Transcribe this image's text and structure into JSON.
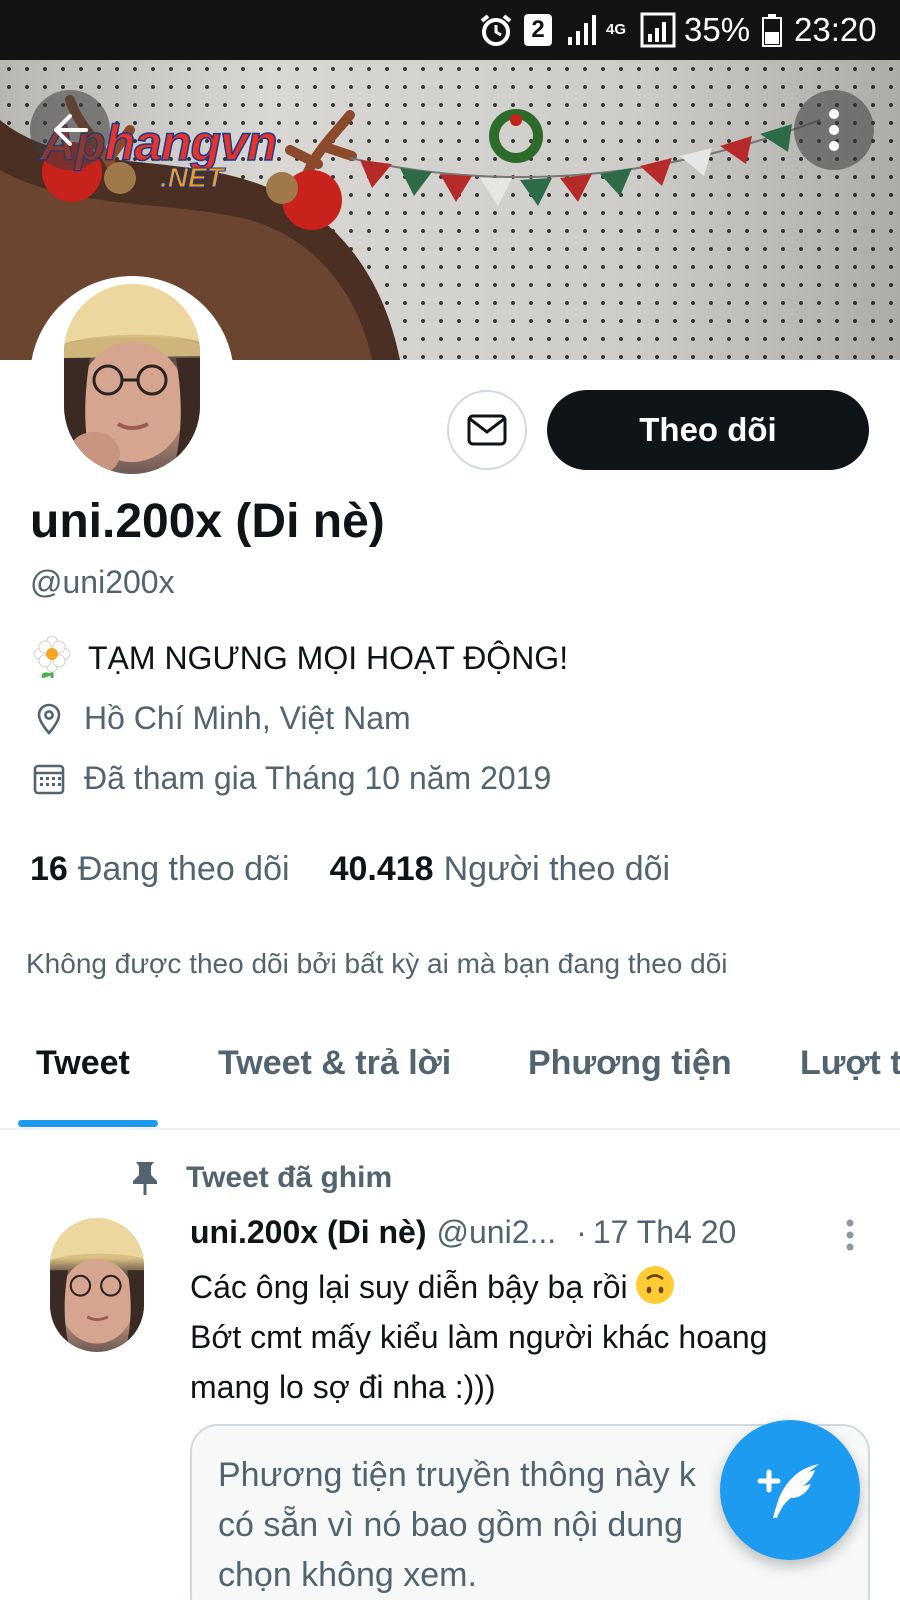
{
  "status_bar": {
    "notification_count": "2",
    "network": "4G",
    "battery": "35%",
    "time": "23:20"
  },
  "watermark": {
    "line1": "Aphangvn",
    "line2": ".NET"
  },
  "profile": {
    "display_name": "uni.200x (Di nè)",
    "handle": "@uni200x",
    "bio": "TẠM NGƯNG MỌI HOẠT ĐỘNG!",
    "location": "Hồ Chí Minh, Việt Nam",
    "joined": "Đã tham gia Tháng 10 năm 2019",
    "following_count": "16",
    "following_label": "Đang theo dõi",
    "followers_count": "40.418",
    "followers_label": "Người theo dõi",
    "follow_button": "Theo dõi",
    "not_followed_notice": "Không được theo dõi bởi bất kỳ ai mà bạn đang theo dõi"
  },
  "tabs": [
    {
      "label": "Tweet",
      "active": true
    },
    {
      "label": "Tweet & trả lời",
      "active": false
    },
    {
      "label": "Phương tiện",
      "active": false
    },
    {
      "label": "Lượt t",
      "active": false
    }
  ],
  "tweet": {
    "pinned_label": "Tweet đã ghim",
    "author_name": "uni.200x (Di nè)",
    "author_handle": "@uni2...",
    "separator": "·",
    "date": "17 Th4 20",
    "text_line1": "Các ông lại suy diễn bậy bạ rồi",
    "text_line2": "Bớt cmt mấy kiểu làm người khác hoang",
    "text_line3": "mang lo sợ đi nha :)))",
    "media_notice_line1": "Phương tiện truyền thông này k",
    "media_notice_line2": "có sẵn vì nó bao gồm nội dung",
    "media_notice_line3": "chọn không xem."
  },
  "colors": {
    "accent": "#1d9bf0",
    "primary_text": "#0f1419",
    "secondary_text": "#536471",
    "border": "#cfd9de"
  },
  "icons": {
    "back": "arrow-left-icon",
    "more": "vertical-dots-icon",
    "message": "envelope-icon",
    "location": "map-pin-icon",
    "calendar": "calendar-icon",
    "pinned": "pin-icon",
    "compose": "compose-feather-icon"
  }
}
